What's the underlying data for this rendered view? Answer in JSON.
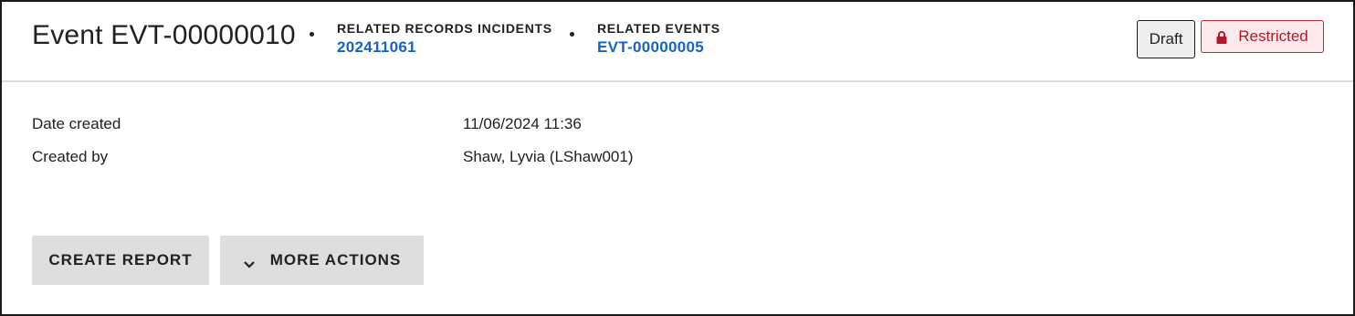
{
  "header": {
    "title": "Event EVT-00000010",
    "related_incidents": {
      "label": "RELATED RECORDS INCIDENTS",
      "value": "202411061"
    },
    "related_events": {
      "label": "RELATED EVENTS",
      "value": "EVT-00000005"
    },
    "status_badge": "Draft",
    "access_badge": {
      "label": "Restricted",
      "icon": "lock-icon",
      "color": "#c62838"
    }
  },
  "details": [
    {
      "key": "Date created",
      "value": "11/06/2024 11:36"
    },
    {
      "key": "Created by",
      "value": "Shaw, Lyvia (LShaw001)"
    }
  ],
  "actions": {
    "create_report": "CREATE REPORT",
    "more_actions": "MORE ACTIONS",
    "more_actions_icon": "chevron-down-icon"
  },
  "colors": {
    "link": "#1565c0",
    "button_bg": "#dedede",
    "restricted_bg": "#fdeaec"
  }
}
